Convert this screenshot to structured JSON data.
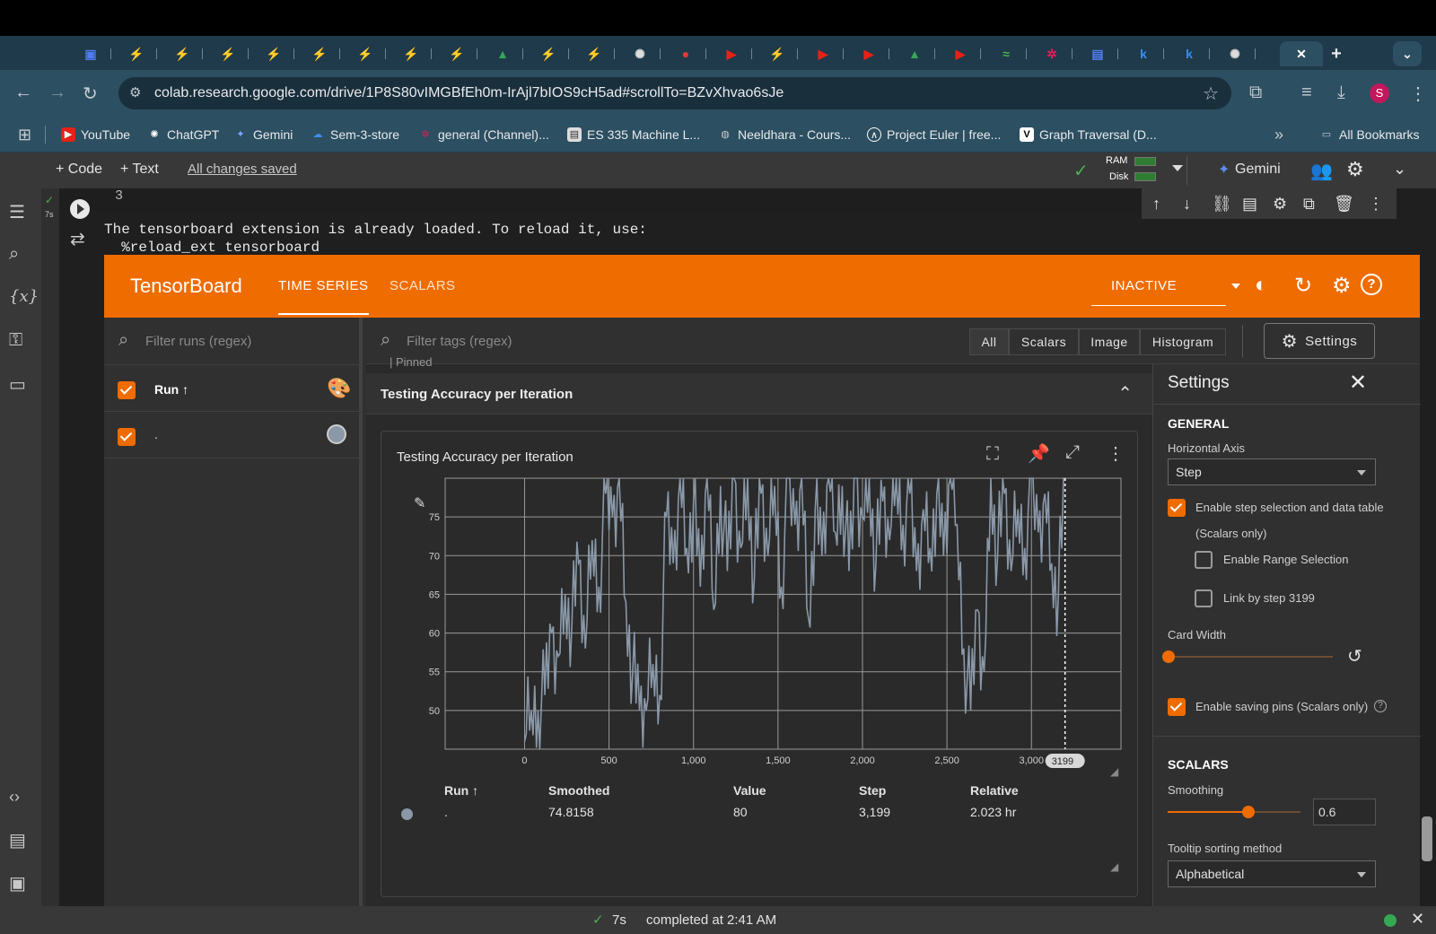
{
  "browser": {
    "url": "colab.research.google.com/drive/1P8S80vIMGBfEh0m-IrAjl7bIOS9cH5ad#scrollTo=BZvXhvao6sJe",
    "profile_initial": "S",
    "new_tab_glyph": "+",
    "close_tab_glyph": "✕",
    "bookmarks": [
      "YouTube",
      "ChatGPT",
      "Gemini",
      "Sem-3-store",
      "general (Channel)...",
      "ES 335 Machine L...",
      "Neeldhara - Cours...",
      "Project Euler | free...",
      "Graph Traversal (D..."
    ],
    "all_bookmarks": "All Bookmarks",
    "overflow": "»"
  },
  "colab": {
    "add_code": "+ Code",
    "add_text": "+ Text",
    "save_status": "All changes saved",
    "ram_label": "RAM",
    "disk_label": "Disk",
    "gemini_label": "Gemini",
    "exec_time_gutter": "7s",
    "cell_prev_line": "3",
    "output_line1": "The tensorboard extension is already loaded. To reload it, use:",
    "output_line2": "  %reload_ext tensorboard",
    "status_time": "7s",
    "status_text": "completed at 2:41 AM"
  },
  "tensorboard": {
    "title": "TensorBoard",
    "tabs": [
      "TIME SERIES",
      "SCALARS"
    ],
    "status": "INACTIVE",
    "filter_runs_placeholder": "Filter runs (regex)",
    "filter_tags_placeholder": "Filter tags (regex)",
    "type_filters": [
      "All",
      "Scalars",
      "Image",
      "Histogram"
    ],
    "settings_button": "Settings",
    "run_column": "Run ↑",
    "run_name": ".",
    "pinned_label": "Pinned",
    "group_title": "Testing Accuracy per Iteration",
    "card_title": "Testing Accuracy per Iteration",
    "selected_step_chip": "3199",
    "table": {
      "headers": [
        "Run ↑",
        "Smoothed",
        "Value",
        "Step",
        "Relative"
      ],
      "row": [
        ".",
        "74.8158",
        "80",
        "3,199",
        "2.023 hr"
      ]
    }
  },
  "settings_panel": {
    "title": "Settings",
    "general_heading": "GENERAL",
    "horizontal_axis_label": "Horizontal Axis",
    "horizontal_axis_value": "Step",
    "enable_step_selection": "Enable step selection and data table",
    "scalars_only": "(Scalars only)",
    "enable_range_selection": "Enable Range Selection",
    "link_by_step": "Link by step 3199",
    "card_width_label": "Card Width",
    "enable_saving_pins": "Enable saving pins (Scalars only)",
    "scalars_heading": "SCALARS",
    "smoothing_label": "Smoothing",
    "smoothing_value": "0.6",
    "tooltip_sorting_label": "Tooltip sorting method",
    "tooltip_sorting_value": "Alphabetical"
  },
  "chart_data": {
    "type": "line",
    "title": "Testing Accuracy per Iteration",
    "xlabel": "",
    "ylabel": "",
    "xlim": [
      -470,
      3530
    ],
    "ylim": [
      45,
      80
    ],
    "x_ticks": [
      0,
      500,
      1000,
      1500,
      2000,
      2500,
      3000
    ],
    "x_tick_labels": [
      "0",
      "500",
      "1,000",
      "1,500",
      "2,000",
      "2,500",
      "3,000"
    ],
    "y_ticks": [
      50,
      55,
      60,
      65,
      70,
      75
    ],
    "selected_step": 3199,
    "grid": true,
    "series": [
      {
        "color": "#8a98a8",
        "x": [
          0,
          40,
          80,
          120,
          160,
          200,
          240,
          280,
          320,
          360,
          400,
          440,
          480,
          520,
          560,
          600,
          640,
          680,
          720,
          760,
          800,
          840,
          880,
          920,
          960,
          1000,
          1040,
          1080,
          1120,
          1160,
          1200,
          1240,
          1280,
          1320,
          1360,
          1400,
          1440,
          1480,
          1520,
          1560,
          1600,
          1640,
          1680,
          1720,
          1760,
          1800,
          1840,
          1880,
          1920,
          1960,
          2000,
          2040,
          2080,
          2120,
          2160,
          2200,
          2240,
          2280,
          2320,
          2360,
          2400,
          2440,
          2480,
          2520,
          2560,
          2600,
          2640,
          2680,
          2720,
          2760,
          2800,
          2840,
          2880,
          2920,
          2960,
          3000,
          3040,
          3080,
          3120,
          3160,
          3199
        ],
        "values": [
          46,
          50,
          50,
          52,
          60,
          57,
          65,
          61,
          69,
          58,
          72,
          66,
          78,
          75,
          80,
          64,
          55,
          50,
          50,
          56,
          52,
          75,
          69,
          80,
          71,
          77,
          66,
          80,
          63,
          79,
          68,
          80,
          71,
          80,
          67,
          78,
          70,
          79,
          66,
          80,
          74,
          80,
          62,
          76,
          70,
          80,
          73,
          79,
          68,
          80,
          75,
          80,
          69,
          77,
          72,
          80,
          74,
          78,
          68,
          76,
          71,
          78,
          70,
          80,
          74,
          58,
          50,
          63,
          55,
          80,
          70,
          78,
          68,
          76,
          71,
          80,
          73,
          78,
          69,
          65,
          80
        ]
      }
    ]
  }
}
